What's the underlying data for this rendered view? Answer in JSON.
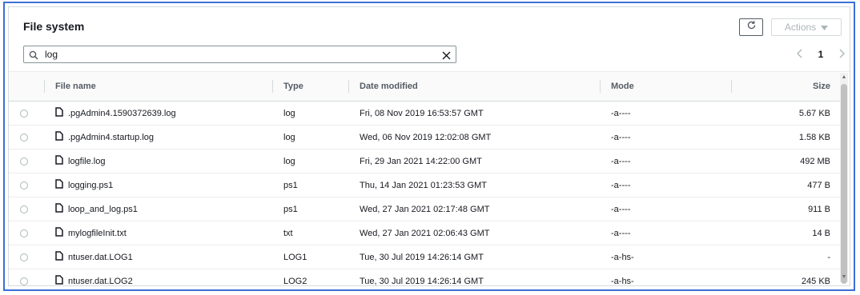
{
  "panel": {
    "title": "File system",
    "actions_label": "Actions"
  },
  "search": {
    "value": "log"
  },
  "pager": {
    "current_page": "1"
  },
  "table": {
    "headers": {
      "name": "File name",
      "type": "Type",
      "date": "Date modified",
      "mode": "Mode",
      "size": "Size"
    },
    "rows": [
      {
        "name": ".pgAdmin4.1590372639.log",
        "type": "log",
        "date": "Fri, 08 Nov 2019 16:53:57 GMT",
        "mode": "-a----",
        "size": "5.67 KB"
      },
      {
        "name": ".pgAdmin4.startup.log",
        "type": "log",
        "date": "Wed, 06 Nov 2019 12:02:08 GMT",
        "mode": "-a----",
        "size": "1.58 KB"
      },
      {
        "name": "logfile.log",
        "type": "log",
        "date": "Fri, 29 Jan 2021 14:22:00 GMT",
        "mode": "-a----",
        "size": "492 MB"
      },
      {
        "name": "logging.ps1",
        "type": "ps1",
        "date": "Thu, 14 Jan 2021 01:23:53 GMT",
        "mode": "-a----",
        "size": "477 B"
      },
      {
        "name": "loop_and_log.ps1",
        "type": "ps1",
        "date": "Wed, 27 Jan 2021 02:17:48 GMT",
        "mode": "-a----",
        "size": "911 B"
      },
      {
        "name": "mylogfileInit.txt",
        "type": "txt",
        "date": "Wed, 27 Jan 2021 02:06:43 GMT",
        "mode": "-a----",
        "size": "14 B"
      },
      {
        "name": "ntuser.dat.LOG1",
        "type": "LOG1",
        "date": "Tue, 30 Jul 2019 14:26:14 GMT",
        "mode": "-a-hs-",
        "size": "-"
      },
      {
        "name": "ntuser.dat.LOG2",
        "type": "LOG2",
        "date": "Tue, 30 Jul 2019 14:26:14 GMT",
        "mode": "-a-hs-",
        "size": "245 KB"
      }
    ]
  },
  "icons": {
    "refresh": "refresh-icon",
    "dropdown": "caret-down-icon",
    "search": "search-icon",
    "clear": "close-icon",
    "prev": "chevron-left-icon",
    "next": "chevron-right-icon",
    "file": "file-icon"
  },
  "colors": {
    "frame_border": "#3b6fd6",
    "disabled_text": "#aab7b8"
  }
}
